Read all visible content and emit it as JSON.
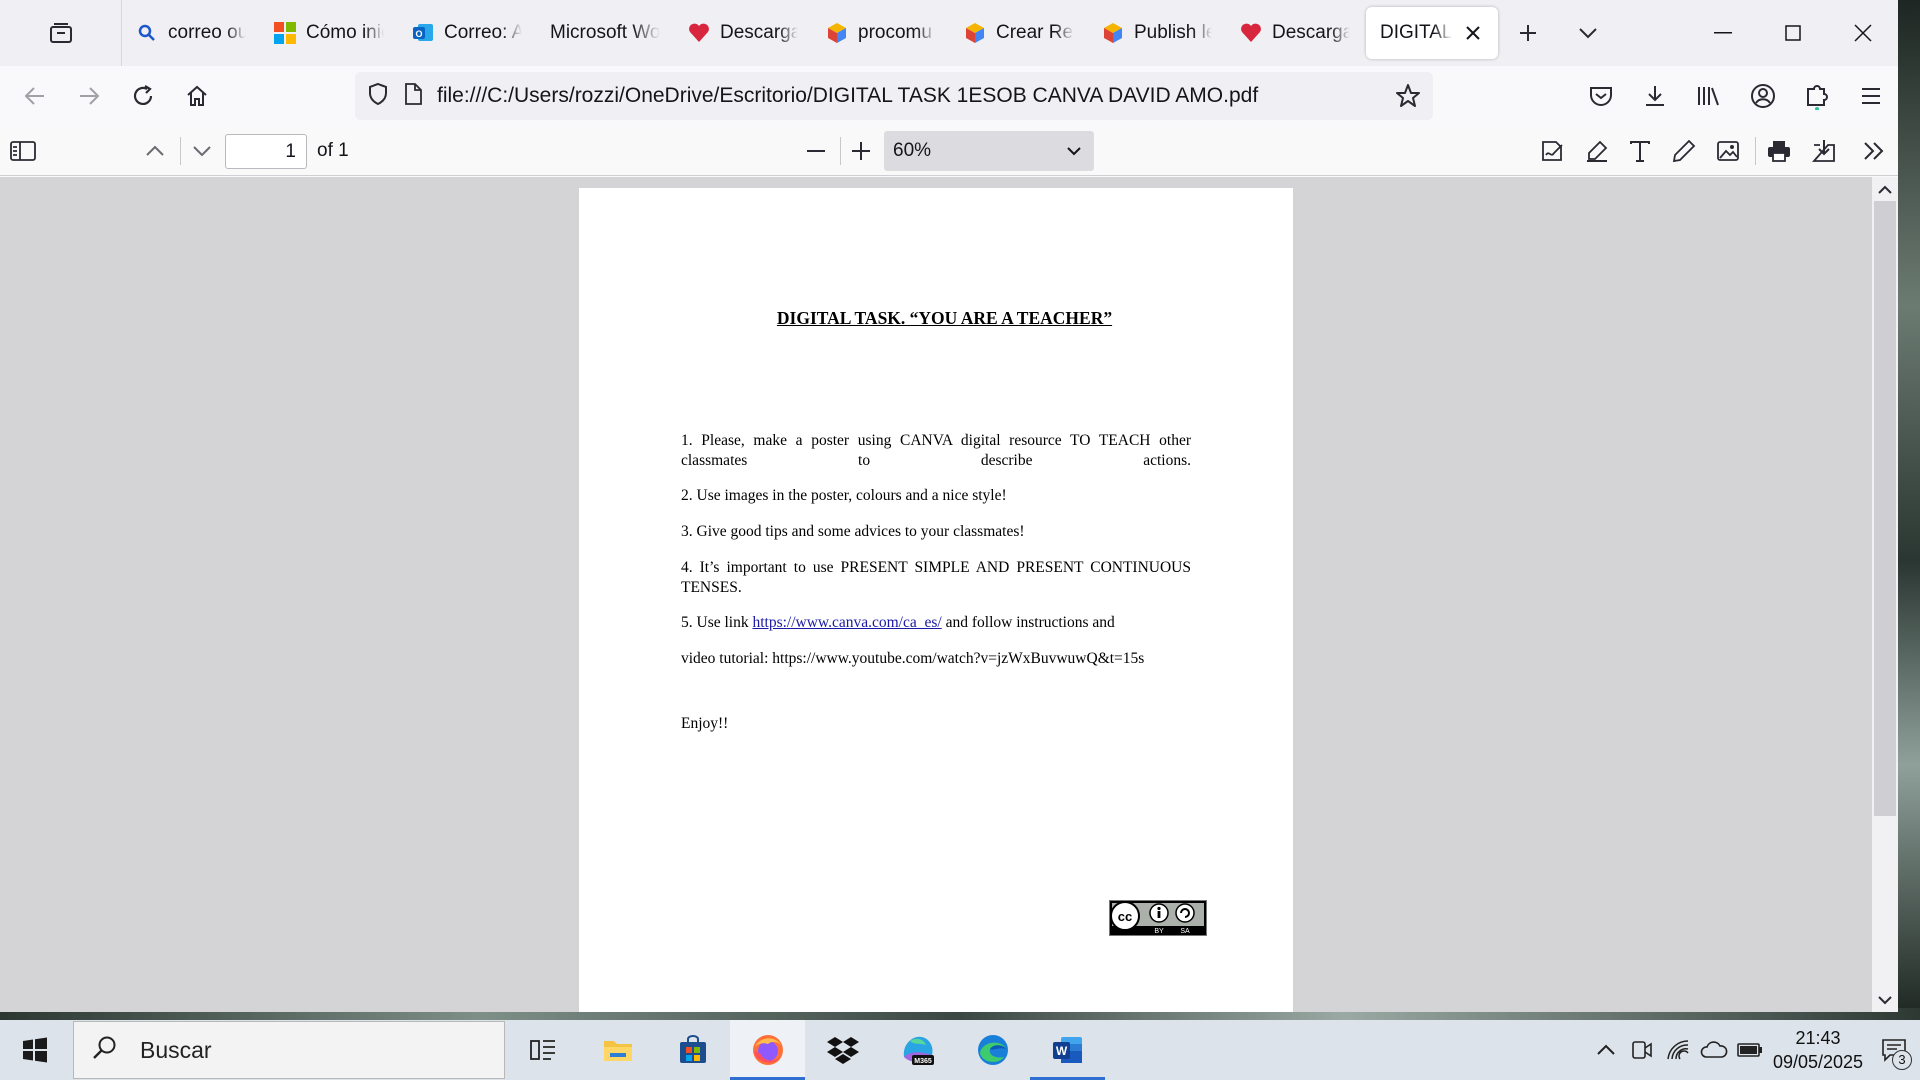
{
  "browser": {
    "tabs": [
      {
        "label": "correo ou",
        "icon": "search-icon"
      },
      {
        "label": "Cómo inic",
        "icon": "microsoft-logo-icon"
      },
      {
        "label": "Correo: A",
        "icon": "outlook-icon"
      },
      {
        "label": "Microsoft Wo",
        "icon": "none"
      },
      {
        "label": "Descarga",
        "icon": "heart-icon"
      },
      {
        "label": "procomu",
        "icon": "cube-icon"
      },
      {
        "label": "Crear Rec",
        "icon": "cube-icon"
      },
      {
        "label": "Publish le",
        "icon": "cube-icon"
      },
      {
        "label": "Descarga",
        "icon": "heart-icon"
      },
      {
        "label": "DIGITAL TA",
        "icon": "none",
        "active": true
      }
    ],
    "url": "file:///C:/Users/rozzi/OneDrive/Escritorio/DIGITAL TASK 1ESOB CANVA DAVID AMO.pdf"
  },
  "pdf_toolbar": {
    "page_number": "1",
    "page_count_label": "of 1",
    "zoom": "60%"
  },
  "document": {
    "title": "DIGITAL TASK. “YOU ARE A TEACHER”",
    "item1": "1. Please, make a poster using CANVA digital resource TO TEACH other classmates to describe actions.",
    "item2": "2. Use images in the poster, colours and a nice style!",
    "item3": "3. Give good tips and some advices to your classmates!",
    "item4": "4. It’s important to use PRESENT SIMPLE AND PRESENT CONTINUOUS TENSES.",
    "item5_prefix": "5. Use link ",
    "item5_link": "https://www.canva.com/ca_es/",
    "item5_suffix": " and follow instructions and",
    "video_line": "video tutorial: https://www.youtube.com/watch?v=jzWxBuvwuwQ&t=15s",
    "closing": "Enjoy!!",
    "license_badge": "CC BY SA"
  },
  "taskbar": {
    "search_label": "Buscar",
    "clock_time": "21:43",
    "clock_date": "09/05/2025",
    "notification_count": "3"
  },
  "colors": {
    "accent": "#2f6fd1",
    "link": "#1a1aa6",
    "tabstrip": "#f0f0f4",
    "viewer_bg": "#d4d4d7"
  }
}
